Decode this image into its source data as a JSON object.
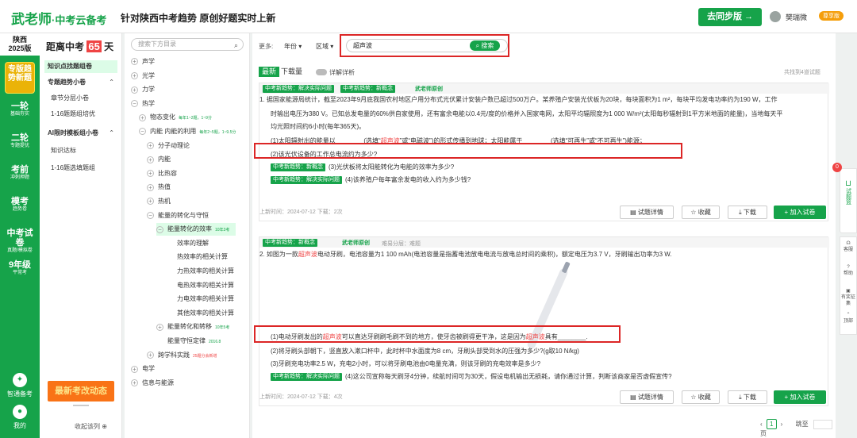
{
  "header": {
    "logo": "武老师",
    "logo_sub": "·中考云备考",
    "slogan": "针对陕西中考趋势 原创好题实时上新",
    "sync_btn": "去同步版 →",
    "user": "樊瑞微",
    "vip": "尊享版"
  },
  "rail": {
    "province": "陕西",
    "year": "2025版",
    "items": [
      {
        "label": "专版趋势新题",
        "sub": ""
      },
      {
        "label": "一轮",
        "sub": "基础夯实"
      },
      {
        "label": "二轮",
        "sub": "专题提优"
      },
      {
        "label": "考前",
        "sub": "冲刺押题"
      },
      {
        "label": "模考",
        "sub": "趋势卷"
      },
      {
        "label": "中考试卷",
        "sub": "真题/模拟卷"
      },
      {
        "label": "9年级",
        "sub": "平常考"
      }
    ],
    "smart": "智通备考",
    "mine": "我的"
  },
  "countdown": {
    "prefix": "距离中考",
    "days": "65",
    "suffix": "天"
  },
  "col2": {
    "items": [
      {
        "label": "知识点找题组卷",
        "type": "sel"
      },
      {
        "label": "专题趋势小卷",
        "type": "hd"
      },
      {
        "label": "章节分层小卷",
        "type": "ind"
      },
      {
        "label": "1-16题题组培优",
        "type": "ind"
      },
      {
        "label": "AI限时模板组小卷",
        "type": "hd"
      },
      {
        "label": "知识达标",
        "type": "ind"
      },
      {
        "label": "1-16题选填题组",
        "type": "ind"
      }
    ],
    "banner": "最新考改动态",
    "collapse": "收起该列 ⊕"
  },
  "tree": {
    "search_placeholder": "搜索下方目录",
    "nodes": [
      {
        "label": "声学",
        "pm": "+",
        "lvl": 0
      },
      {
        "label": "光学",
        "pm": "+",
        "lvl": 0
      },
      {
        "label": "力学",
        "pm": "+",
        "lvl": 0
      },
      {
        "label": "热学",
        "pm": "−",
        "lvl": 0
      },
      {
        "label": "物态变化",
        "pm": "+",
        "lvl": 1,
        "note": "每年1~2题，1~9分"
      },
      {
        "label": "内能 内能的利用",
        "pm": "−",
        "lvl": 1,
        "note": "每年2~5题，1~9.5分"
      },
      {
        "label": "分子动理论",
        "pm": "+",
        "lvl": 2
      },
      {
        "label": "内能",
        "pm": "+",
        "lvl": 2
      },
      {
        "label": "比热容",
        "pm": "+",
        "lvl": 2
      },
      {
        "label": "热值",
        "pm": "+",
        "lvl": 2
      },
      {
        "label": "热机",
        "pm": "+",
        "lvl": 2
      },
      {
        "label": "能量的转化与守恒",
        "pm": "−",
        "lvl": 2
      },
      {
        "label": "能量转化的效率",
        "pm": "−",
        "lvl": 3,
        "note": "10年3考",
        "sel": true
      },
      {
        "label": "效率的理解",
        "lvl": 4
      },
      {
        "label": "热效率的相关计算",
        "lvl": 4
      },
      {
        "label": "力热效率的相关计算",
        "lvl": 4
      },
      {
        "label": "电热效率的相关计算",
        "lvl": 4
      },
      {
        "label": "力电效率的相关计算",
        "lvl": 4
      },
      {
        "label": "其他效率的相关计算",
        "lvl": 4
      },
      {
        "label": "能量转化和转移",
        "pm": "+",
        "lvl": 3,
        "note": "10年5考"
      },
      {
        "label": "能量守恒定律",
        "lvl": 3,
        "note": "2016.8"
      },
      {
        "label": "跨学科实践",
        "pm": "+",
        "lvl": 2,
        "note": "25题分会新增",
        "red": true
      },
      {
        "label": "电学",
        "pm": "+",
        "lvl": 0
      },
      {
        "label": "信息与能源",
        "pm": "+",
        "lvl": 0
      }
    ]
  },
  "filters": {
    "more": "更多:",
    "year": "年份 ▾",
    "region": "区域 ▾",
    "search_value": "超声波",
    "search_btn": "⌕ 搜索"
  },
  "tabs": {
    "latest": "最新",
    "downloads": "下载量",
    "toggle": "详解详析",
    "total": "共找到4道试题"
  },
  "q1": {
    "tag1": "中考新趋势：解决实际问题",
    "tag2": "中考新趋势：新概念",
    "teacher": "武老师原创",
    "stem1a": "1.  据国家能源局统计，截至2023年9月底我国农村地区户用分布式光伏累计安装户数已超过500万户。某养殖户安装光伏板为20块，每块面积为1 m²，每块平均发电功率约为190 W，工作",
    "stem1b": "时输出电压为380 V。已知总发电量的60%供自家使用，还有富余电能以0.4元/度的价格并入国家电网，太阳平均辐照度为1 000 W/m²(太阳每秒辐射到1平方米地面的能量)，当地每天平",
    "stem1c": "均光照时间约6小时(每年365天)。",
    "p1_pre": "(1)太阳辐射出的能量以________(选填“",
    "p1_hl": "超声波",
    "p1_post": "”或“电磁波”)的形式传播到地球；太阳能属于________(选填“可再生”或“不可再生”)能源；",
    "p2": "(2)该光伏设备的工作总电流约为多少?",
    "p3": "(3)光伏板将太阳能转化为电能的效率为多少?",
    "p4": "(4)该养殖户每年富余发电的收入约为多少钱?",
    "updated": "上新时间：2024-07-12    下载：2次"
  },
  "q2": {
    "tag1": "中考新趋势：新概念",
    "teacher": "武老师原创",
    "meta": "难易分层：难题",
    "stem_pre": "2.  如图为一款",
    "stem_hl": "超声波",
    "stem_post": "电动牙刷，电池容量为1 100 mAh(电池容量是指蓄电池放电电流与放电总时间的乘积)，额定电压为3.7 V，牙刷输出功率为3 W.",
    "p1_a": "(1)电动牙刷发出的",
    "p1_hl1": "超声波",
    "p1_b": "可以直达牙刷刷毛刷不到的地方，使牙齿被刷得更干净，这是因为",
    "p1_hl2": "超声波",
    "p1_c": "具有________.",
    "p2": "(2)将牙刷头部朝下，竖直放入漱口杯中，此时杯中水面度为8 cm，牙刷头部受到水的压强为多少?(g取10 N/kg)",
    "p3": "(3)牙刷充电功率2.5 W，充电2小时，可以将牙刷电池由0电量充满，则该牙刷的充电效率是多少?",
    "p4": "(4)这公司宣称每天刷牙4分钟，续航时间可为30天，假设电机输出无损耗，请你通过计算，判断该商家是否虚假宣传?",
    "updated": "上新时间：2024-07-12    下载：4次"
  },
  "actions": {
    "detail": "▤  试题详情",
    "fav": "☆  收藏",
    "dl": "⤓  下载",
    "add": "+  加入试卷"
  },
  "pager": {
    "page": "1",
    "goto": "跳至",
    "unit": "页"
  },
  "right_tools": {
    "basket": "试题篮",
    "badge": "0",
    "service": "客服",
    "help": "帮助",
    "feedback": "有奖征集",
    "top": "顶部"
  }
}
